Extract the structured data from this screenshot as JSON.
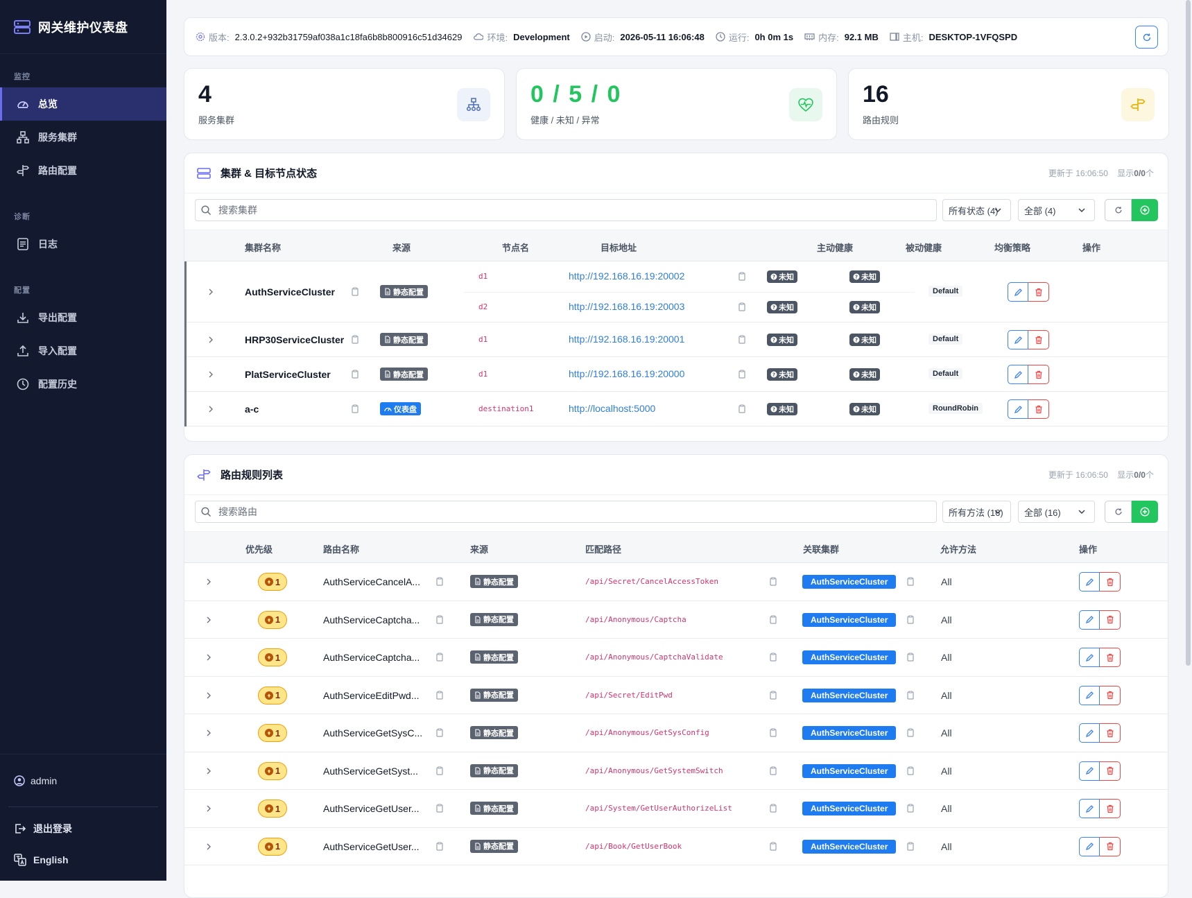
{
  "app": {
    "title": "网关维护仪表盘"
  },
  "sidebar": {
    "sections": [
      {
        "label": "监控",
        "items": [
          {
            "label": "总览",
            "icon": "dashboard-icon",
            "active": true
          },
          {
            "label": "服务集群",
            "icon": "cluster-icon"
          },
          {
            "label": "路由配置",
            "icon": "signpost-icon"
          }
        ]
      },
      {
        "label": "诊断",
        "items": [
          {
            "label": "日志",
            "icon": "log-icon"
          }
        ]
      },
      {
        "label": "配置",
        "items": [
          {
            "label": "导出配置",
            "icon": "download-icon"
          },
          {
            "label": "导入配置",
            "icon": "upload-icon"
          },
          {
            "label": "配置历史",
            "icon": "history-icon"
          }
        ]
      }
    ],
    "user": "admin",
    "logout": "退出登录",
    "language": "English"
  },
  "meta": {
    "version_label": "版本:",
    "version": "2.3.0.2+932b31759af038a1c18fa6b8b800916c51d34629",
    "env_label": "环境:",
    "env": "Development",
    "start_label": "启动:",
    "start": "2026-05-11 16:06:48",
    "uptime_label": "运行:",
    "uptime": "0h 0m 1s",
    "memory_label": "内存:",
    "memory": "92.1 MB",
    "host_label": "主机:",
    "host": "DESKTOP-1VFQSPD"
  },
  "stats": [
    {
      "value": "4",
      "label": "服务集群",
      "icon": "cluster-icon",
      "color": "#4b6cb7"
    },
    {
      "value": "0 / 5 / 0",
      "label": "健康 / 未知 / 异常",
      "icon": "heartbeat-icon",
      "color": "#22c55e"
    },
    {
      "value": "16",
      "label": "路由规则",
      "icon": "signpost-icon",
      "color": "#eab308"
    }
  ],
  "clusters_panel": {
    "title": "集群 & 目标节点状态",
    "updated": "更新于 16:06:50",
    "shown_prefix": "显示",
    "shown": "0/0",
    "shown_suffix": "个",
    "search_placeholder": "搜索集群",
    "status_filter": "所有状态 (4)",
    "all_filter": "全部 (4)",
    "columns": [
      "集群名称",
      "来源",
      "节点名",
      "目标地址",
      "主动健康",
      "被动健康",
      "均衡策略",
      "操作"
    ],
    "rows": [
      {
        "name": "AuthServiceCluster",
        "source": "静态配置",
        "source_type": "static",
        "policy": "Default",
        "nodes": [
          {
            "node": "d1",
            "url": "http://192.168.16.19:20002",
            "active": "未知",
            "passive": "未知"
          },
          {
            "node": "d2",
            "url": "http://192.168.16.19:20003",
            "active": "未知",
            "passive": "未知"
          }
        ]
      },
      {
        "name": "HRP30ServiceCluster",
        "source": "静态配置",
        "source_type": "static",
        "policy": "Default",
        "nodes": [
          {
            "node": "d1",
            "url": "http://192.168.16.19:20001",
            "active": "未知",
            "passive": "未知"
          }
        ]
      },
      {
        "name": "PlatServiceCluster",
        "source": "静态配置",
        "source_type": "static",
        "policy": "Default",
        "nodes": [
          {
            "node": "d1",
            "url": "http://192.168.16.19:20000",
            "active": "未知",
            "passive": "未知"
          }
        ]
      },
      {
        "name": "a-c",
        "source": "仪表盘",
        "source_type": "dashboard",
        "policy": "RoundRobin",
        "nodes": [
          {
            "node": "destination1",
            "url": "http://localhost:5000",
            "active": "未知",
            "passive": "未知"
          }
        ]
      }
    ]
  },
  "routes_panel": {
    "title": "路由规则列表",
    "updated": "更新于 16:06:50",
    "shown_prefix": "显示",
    "shown": "0/0",
    "shown_suffix": "个",
    "search_placeholder": "搜索路由",
    "method_filter": "所有方法 (16)",
    "all_filter": "全部 (16)",
    "columns": [
      "优先级",
      "路由名称",
      "来源",
      "匹配路径",
      "关联集群",
      "允许方法",
      "操作"
    ],
    "rows": [
      {
        "priority": "1",
        "name": "AuthServiceCancelA...",
        "source": "静态配置",
        "path": "/api/Secret/CancelAccessToken",
        "cluster": "AuthServiceCluster",
        "methods": "All"
      },
      {
        "priority": "1",
        "name": "AuthServiceCaptcha...",
        "source": "静态配置",
        "path": "/api/Anonymous/Captcha",
        "cluster": "AuthServiceCluster",
        "methods": "All"
      },
      {
        "priority": "1",
        "name": "AuthServiceCaptcha...",
        "source": "静态配置",
        "path": "/api/Anonymous/CaptchaValidate",
        "cluster": "AuthServiceCluster",
        "methods": "All"
      },
      {
        "priority": "1",
        "name": "AuthServiceEditPwd...",
        "source": "静态配置",
        "path": "/api/Secret/EditPwd",
        "cluster": "AuthServiceCluster",
        "methods": "All"
      },
      {
        "priority": "1",
        "name": "AuthServiceGetSysC...",
        "source": "静态配置",
        "path": "/api/Anonymous/GetSysConfig",
        "cluster": "AuthServiceCluster",
        "methods": "All"
      },
      {
        "priority": "1",
        "name": "AuthServiceGetSyst...",
        "source": "静态配置",
        "path": "/api/Anonymous/GetSystemSwitch",
        "cluster": "AuthServiceCluster",
        "methods": "All"
      },
      {
        "priority": "1",
        "name": "AuthServiceGetUser...",
        "source": "静态配置",
        "path": "/api/System/GetUserAuthorizeList",
        "cluster": "AuthServiceCluster",
        "methods": "All"
      },
      {
        "priority": "1",
        "name": "AuthServiceGetUser...",
        "source": "静态配置",
        "path": "/api/Book/GetUserBook",
        "cluster": "AuthServiceCluster",
        "methods": "All"
      }
    ]
  },
  "colors": {
    "sidebar_bg": "#131a30",
    "accent": "#6b6df0",
    "link": "#2f7de1",
    "success": "#22c55e",
    "danger": "#ef4444",
    "warning": "#f59e0b"
  }
}
